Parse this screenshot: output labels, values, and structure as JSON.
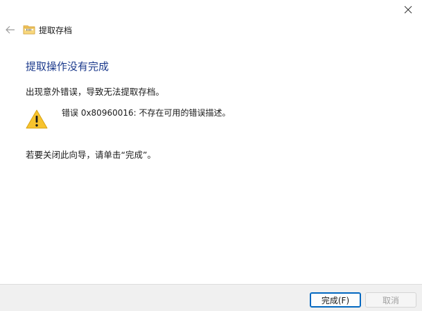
{
  "window": {
    "title": "提取存档"
  },
  "content": {
    "heading": "提取操作没有完成",
    "message": "出现意外错误，导致无法提取存档。",
    "error_detail": "错误 0x80960016: 不存在可用的错误描述。",
    "instruction": "若要关闭此向导，请单击“完成”。"
  },
  "buttons": {
    "finish_label": "完成(F)",
    "cancel_label": "取消"
  },
  "icons": {
    "close": "close-icon",
    "back": "back-arrow-icon",
    "title": "zip-folder-icon",
    "warning": "warning-icon"
  },
  "colors": {
    "heading": "#1c3a8c",
    "accent": "#0067c0",
    "warning_fill": "#f7c32e",
    "footer_bg": "#f0f0f0"
  }
}
